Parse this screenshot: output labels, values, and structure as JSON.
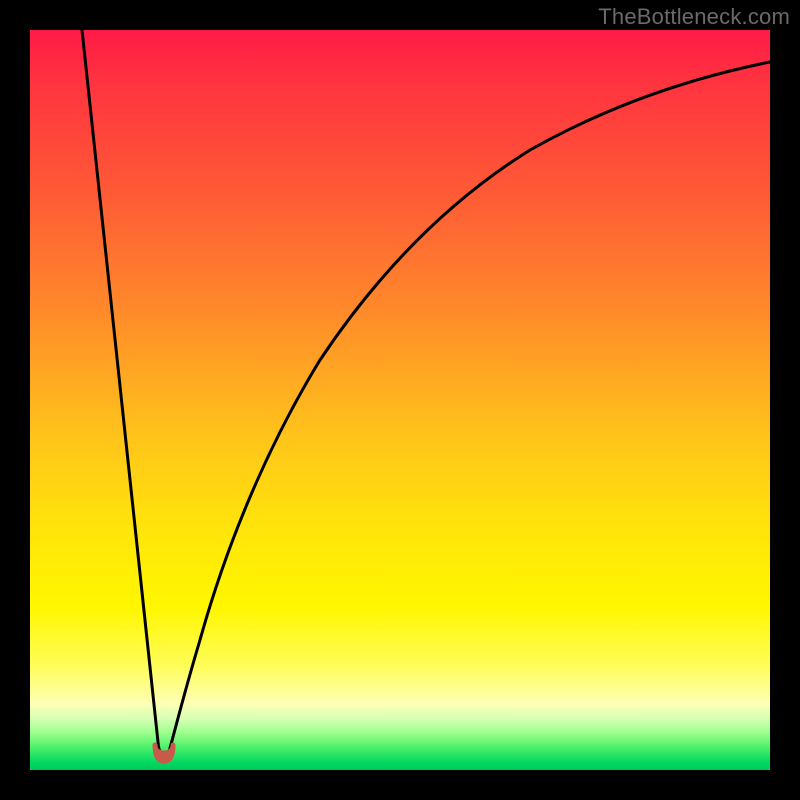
{
  "watermark": "TheBottleneck.com",
  "chart_data": {
    "type": "line",
    "title": "",
    "xlabel": "",
    "ylabel": "",
    "xlim": [
      0,
      100
    ],
    "ylim": [
      0,
      100
    ],
    "grid": false,
    "legend": false,
    "axes_visible": false,
    "background_gradient": {
      "orientation": "vertical",
      "stops": [
        {
          "pos": 0.0,
          "color": "#ff1a47"
        },
        {
          "pos": 0.22,
          "color": "#ff5a36"
        },
        {
          "pos": 0.55,
          "color": "#ffc41a"
        },
        {
          "pos": 0.78,
          "color": "#fff600"
        },
        {
          "pos": 0.95,
          "color": "#9bff8c"
        },
        {
          "pos": 1.0,
          "color": "#00c85a"
        }
      ]
    },
    "series": [
      {
        "name": "bottleneck-profile",
        "color": "#000000",
        "x": [
          0,
          3,
          6,
          9,
          12,
          15,
          17,
          18,
          19,
          20,
          22,
          25,
          30,
          36,
          44,
          54,
          66,
          80,
          100
        ],
        "values": [
          100,
          84,
          68,
          52,
          36,
          20,
          7,
          3,
          3,
          7,
          20,
          38,
          55,
          68,
          78,
          85,
          90,
          93,
          95
        ]
      }
    ],
    "marker": {
      "name": "optimal-point",
      "x": 18.5,
      "y": 2,
      "color": "#cc5a4a",
      "shape": "u"
    }
  }
}
